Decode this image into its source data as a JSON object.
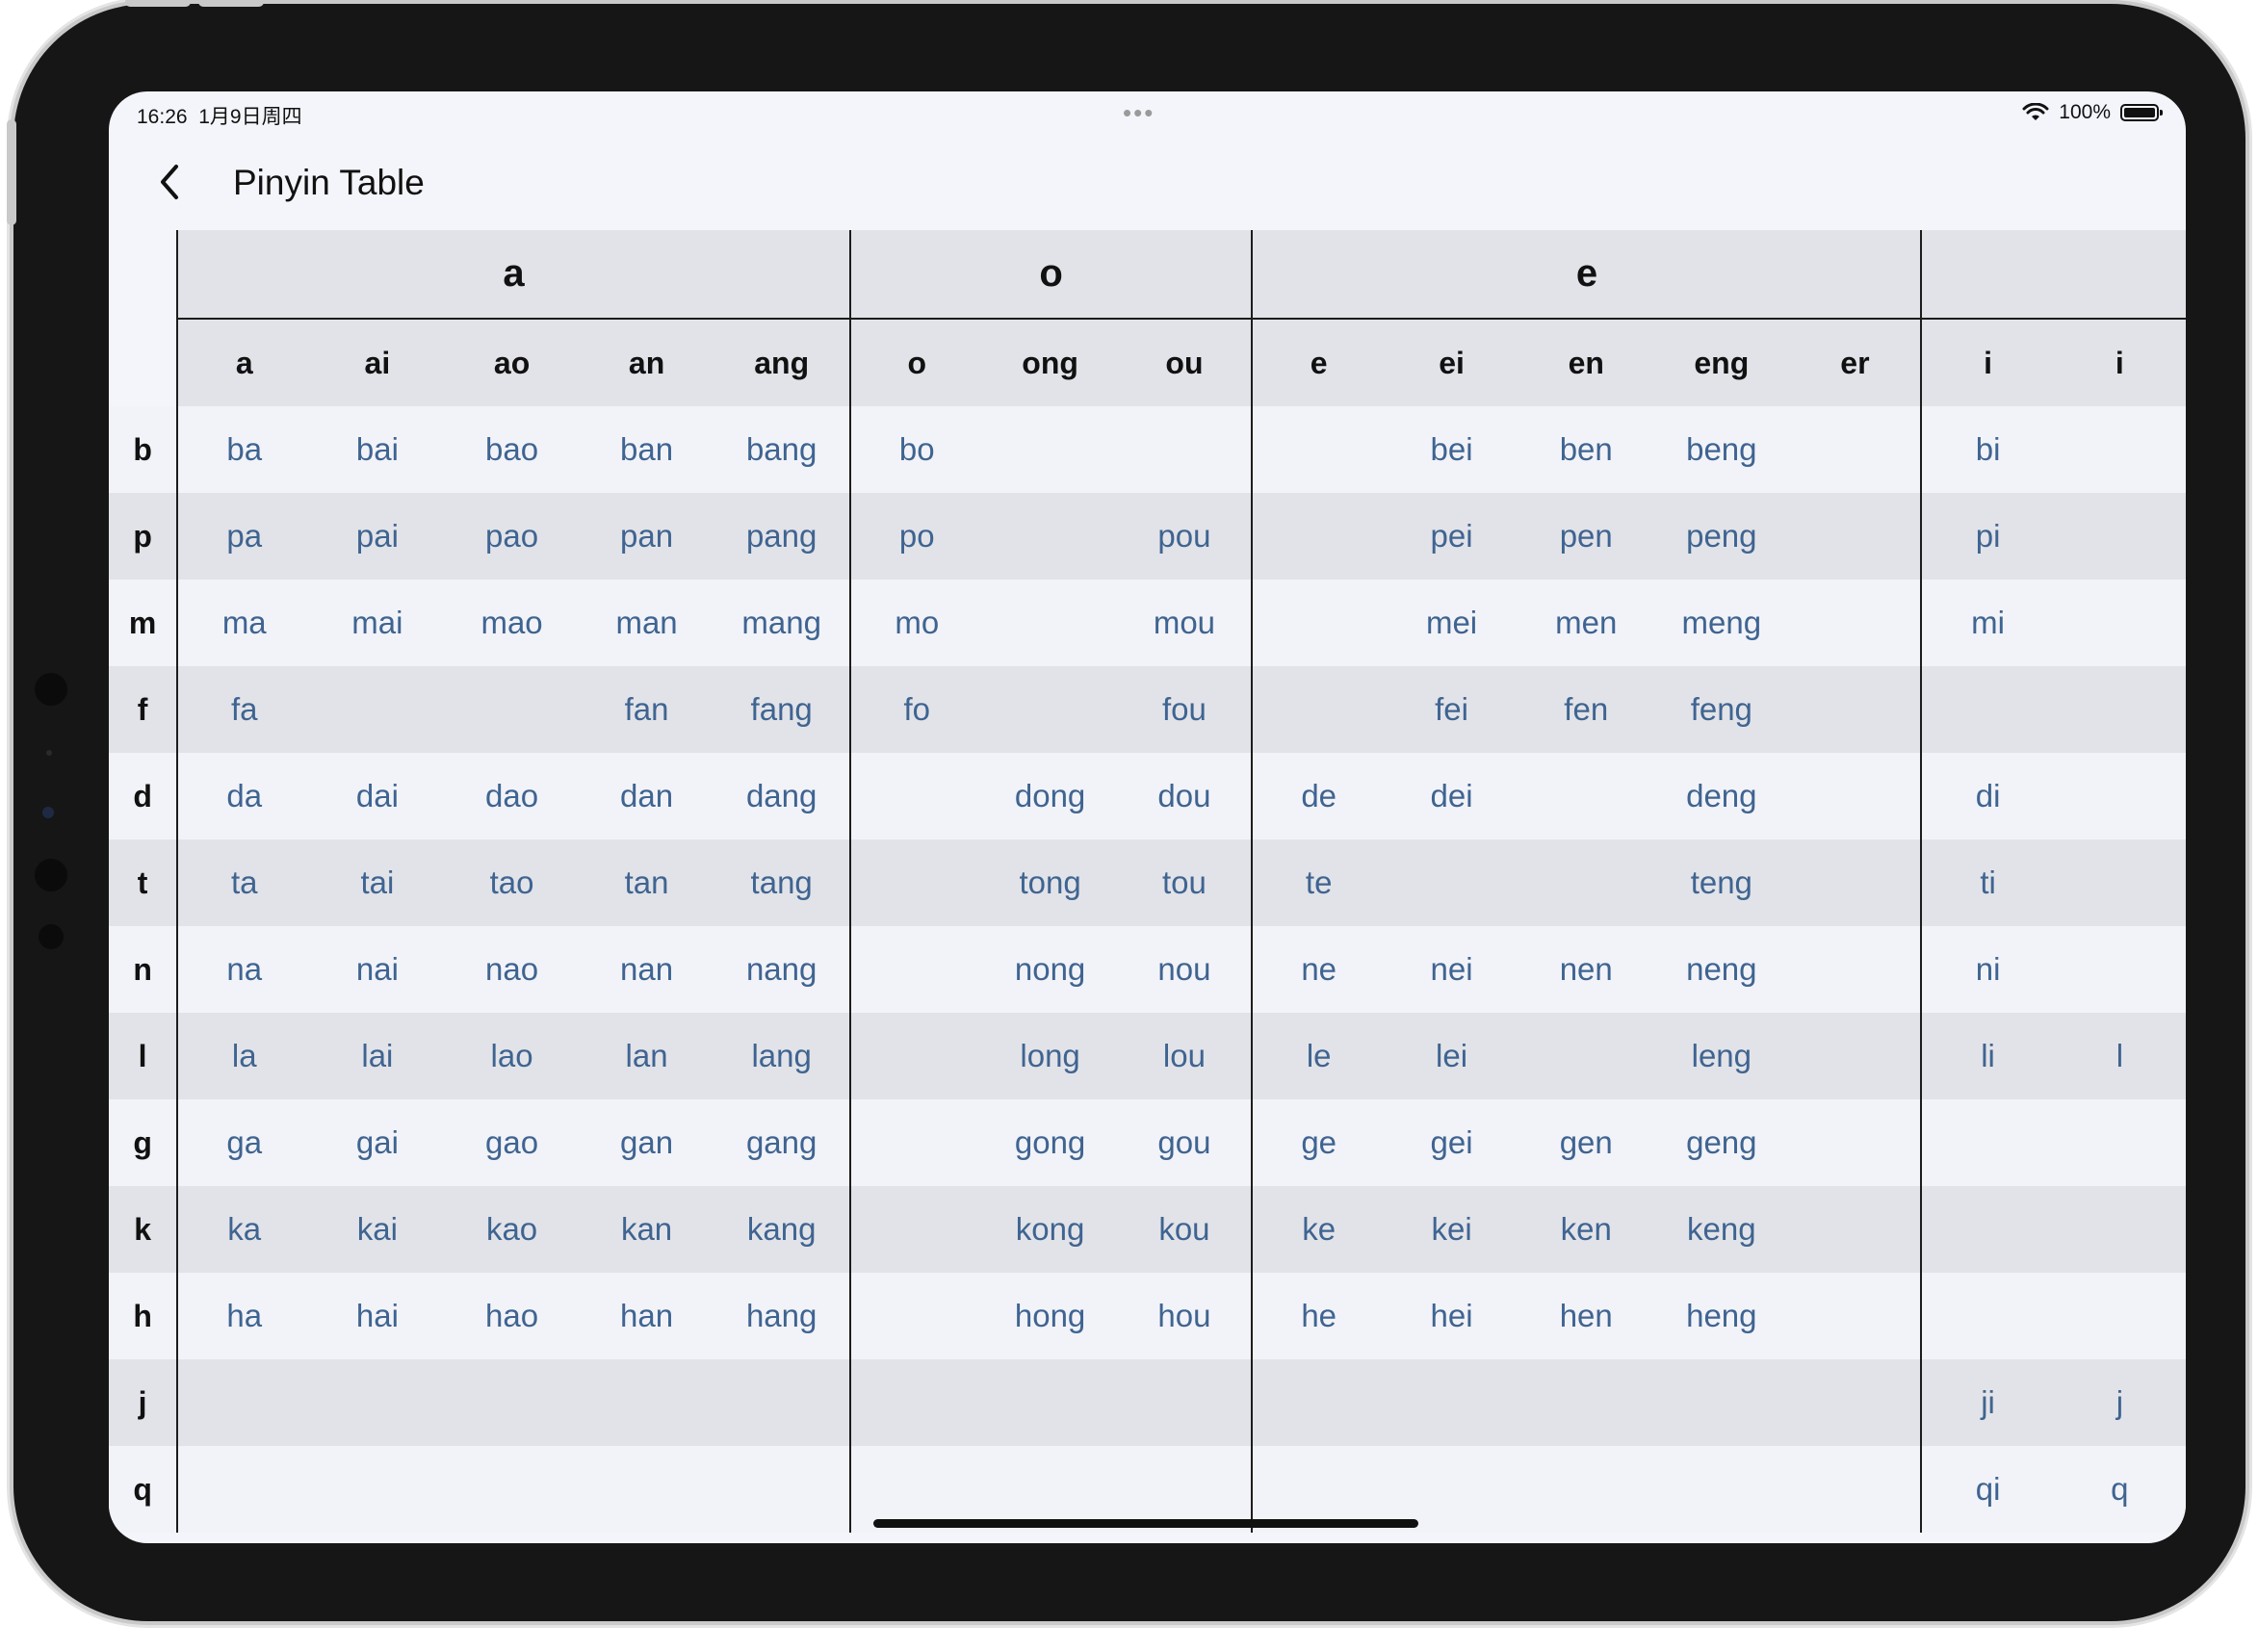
{
  "status_bar": {
    "time": "16:26",
    "date": "1月9日周四",
    "grabber": "•••",
    "battery": "100%"
  },
  "nav": {
    "title": "Pinyin Table",
    "back_icon": "chevron-left-icon"
  },
  "groups": [
    {
      "label": "a",
      "span": 5
    },
    {
      "label": "o",
      "span": 3
    },
    {
      "label": "e",
      "span": 5
    },
    {
      "label": "",
      "span": 2
    }
  ],
  "finals": [
    "a",
    "ai",
    "ao",
    "an",
    "ang",
    "o",
    "ong",
    "ou",
    "e",
    "ei",
    "en",
    "eng",
    "er",
    "i",
    "i"
  ],
  "rows": [
    {
      "initial": "b",
      "cells": [
        "ba",
        "bai",
        "bao",
        "ban",
        "bang",
        "bo",
        "",
        "",
        "",
        "bei",
        "ben",
        "beng",
        "",
        "bi",
        ""
      ]
    },
    {
      "initial": "p",
      "cells": [
        "pa",
        "pai",
        "pao",
        "pan",
        "pang",
        "po",
        "",
        "pou",
        "",
        "pei",
        "pen",
        "peng",
        "",
        "pi",
        ""
      ]
    },
    {
      "initial": "m",
      "cells": [
        "ma",
        "mai",
        "mao",
        "man",
        "mang",
        "mo",
        "",
        "mou",
        "",
        "mei",
        "men",
        "meng",
        "",
        "mi",
        ""
      ]
    },
    {
      "initial": "f",
      "cells": [
        "fa",
        "",
        "",
        "fan",
        "fang",
        "fo",
        "",
        "fou",
        "",
        "fei",
        "fen",
        "feng",
        "",
        "",
        ""
      ]
    },
    {
      "initial": "d",
      "cells": [
        "da",
        "dai",
        "dao",
        "dan",
        "dang",
        "",
        "dong",
        "dou",
        "de",
        "dei",
        "",
        "deng",
        "",
        "di",
        ""
      ]
    },
    {
      "initial": "t",
      "cells": [
        "ta",
        "tai",
        "tao",
        "tan",
        "tang",
        "",
        "tong",
        "tou",
        "te",
        "",
        "",
        "teng",
        "",
        "ti",
        ""
      ]
    },
    {
      "initial": "n",
      "cells": [
        "na",
        "nai",
        "nao",
        "nan",
        "nang",
        "",
        "nong",
        "nou",
        "ne",
        "nei",
        "nen",
        "neng",
        "",
        "ni",
        ""
      ]
    },
    {
      "initial": "l",
      "cells": [
        "la",
        "lai",
        "lao",
        "lan",
        "lang",
        "",
        "long",
        "lou",
        "le",
        "lei",
        "",
        "leng",
        "",
        "li",
        "l"
      ]
    },
    {
      "initial": "g",
      "cells": [
        "ga",
        "gai",
        "gao",
        "gan",
        "gang",
        "",
        "gong",
        "gou",
        "ge",
        "gei",
        "gen",
        "geng",
        "",
        "",
        ""
      ]
    },
    {
      "initial": "k",
      "cells": [
        "ka",
        "kai",
        "kao",
        "kan",
        "kang",
        "",
        "kong",
        "kou",
        "ke",
        "kei",
        "ken",
        "keng",
        "",
        "",
        ""
      ]
    },
    {
      "initial": "h",
      "cells": [
        "ha",
        "hai",
        "hao",
        "han",
        "hang",
        "",
        "hong",
        "hou",
        "he",
        "hei",
        "hen",
        "heng",
        "",
        "",
        ""
      ]
    },
    {
      "initial": "j",
      "cells": [
        "",
        "",
        "",
        "",
        "",
        "",
        "",
        "",
        "",
        "",
        "",
        "",
        "",
        "ji",
        "j"
      ]
    },
    {
      "initial": "q",
      "cells": [
        "",
        "",
        "",
        "",
        "",
        "",
        "",
        "",
        "",
        "",
        "",
        "",
        "",
        "qi",
        "q"
      ]
    }
  ]
}
